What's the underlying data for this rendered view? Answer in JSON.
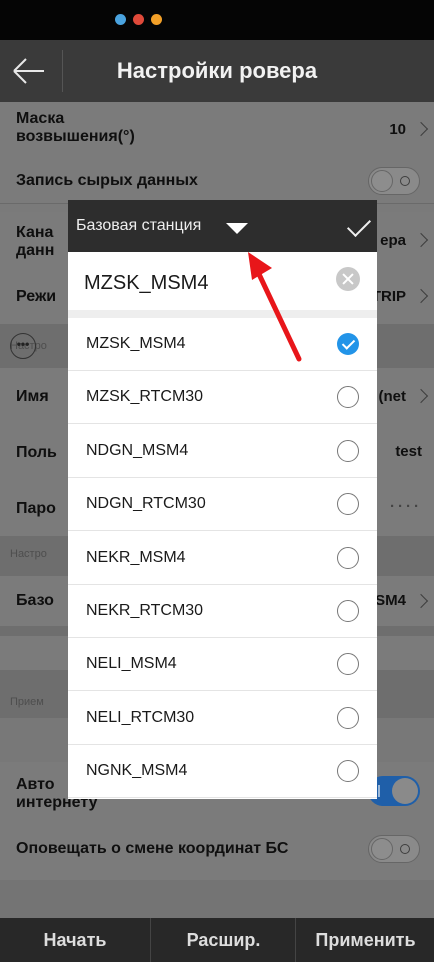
{
  "status_bar": {
    "icons": [
      "telegram-icon",
      "app-icon-red",
      "app-icon-orange"
    ]
  },
  "header": {
    "title": "Настройки ровера",
    "back_icon": "arrow-left-icon"
  },
  "settings": {
    "elevation_mask": {
      "label_line1": "Маска",
      "label_line2": "возвышения(°)",
      "value": "10"
    },
    "raw_data": {
      "label": "Запись сырых данных"
    },
    "data_channel": {
      "label_line1": "Кана",
      "label_line2": "данн",
      "value": "ера"
    },
    "mode": {
      "label": "Режи",
      "value": "TRIP"
    },
    "section_settings_1": {
      "label": "Настро"
    },
    "name": {
      "label": "Имя",
      "value": "(net"
    },
    "user": {
      "label": "Поль",
      "value": "test"
    },
    "password": {
      "label": "Паро",
      "value": "····"
    },
    "section_settings_2": {
      "label": "Настро"
    },
    "base": {
      "label": "Базо",
      "value": "SM4"
    },
    "section_reception": {
      "label": "Прием"
    },
    "auto": {
      "label_line1": "Авто",
      "label_line2": "интернету"
    },
    "notify": {
      "label": "Оповещать о смене координат БС"
    }
  },
  "bottom_bar": {
    "start": "Начать",
    "extended": "Расшир.",
    "apply": "Применить"
  },
  "dropdown": {
    "title": "Базовая станция",
    "search_value": "MZSK_MSM4",
    "selected_index": 0,
    "items": [
      "MZSK_MSM4",
      "MZSK_RTCM30",
      "NDGN_MSM4",
      "NDGN_RTCM30",
      "NEKR_MSM4",
      "NEKR_RTCM30",
      "NELI_MSM4",
      "NELI_RTCM30",
      "NGNK_MSM4"
    ]
  },
  "colors": {
    "accent": "#2294e8",
    "toggle_on": "#1f5fa9",
    "arrow": "#e8161a"
  }
}
